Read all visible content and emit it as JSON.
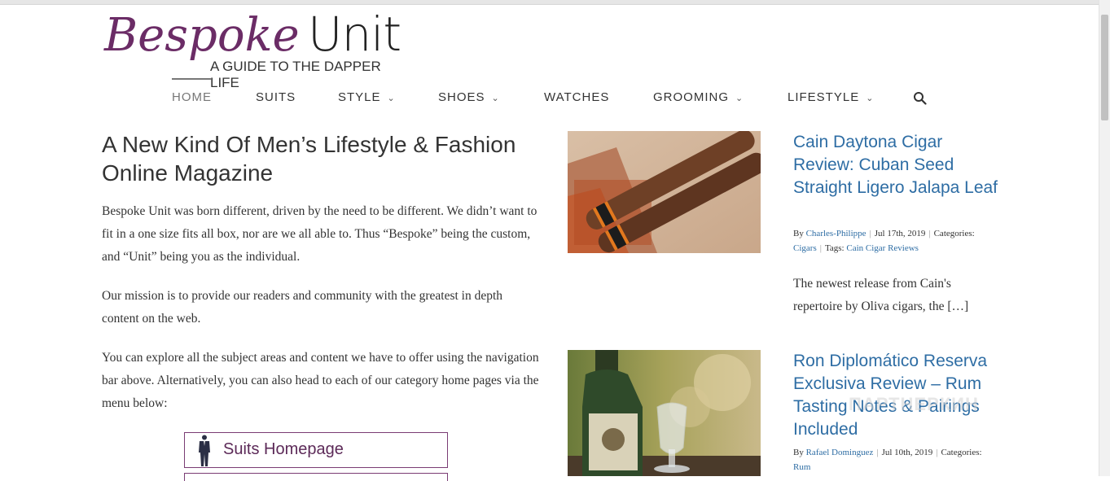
{
  "logo": {
    "script": "Bespoke",
    "unit": "Unit",
    "tagline": "A GUIDE TO THE DAPPER LIFE"
  },
  "nav": {
    "home": "HOME",
    "suits": "SUITS",
    "style": "STYLE",
    "shoes": "SHOES",
    "watches": "WATCHES",
    "grooming": "GROOMING",
    "lifestyle": "LIFESTYLE"
  },
  "intro": {
    "headline": "A New Kind Of Men’s Lifestyle & Fashion Online Magazine",
    "p1": "Bespoke Unit was born different, driven by the need to be different. We didn’t want to fit in a one size fits all box, nor are we all able to. Thus “Bespoke” being the custom, and “Unit” being you as the individual.",
    "p2": "Our mission is to provide our readers and community with the greatest in depth content on the web.",
    "p3": "You can explore all the subject areas and content we have to offer using the navigation bar above. Alternatively, you can also head to each of our category home pages via the menu below:",
    "button1": "Suits Homepage"
  },
  "posts": [
    {
      "title": "Cain Daytona Cigar Review: Cuban Seed Straight Ligero Jalapa Leaf",
      "by": "By",
      "author": "Charles-Philippe",
      "date": "Jul 17th, 2019",
      "categories_label": "Categories:",
      "category": "Cigars",
      "tags_label": "Tags:",
      "tag": "Cain Cigar Reviews",
      "excerpt": "The newest release from Cain's repertoire by Oliva cigars, the […]"
    },
    {
      "title": "Ron Diplomático Reserva Exclusiva Review – Rum Tasting Notes & Pairings Included",
      "by": "By",
      "author": "Rafael Dominguez",
      "date": "Jul 10th, 2019",
      "categories_label": "Categories:",
      "category": "Rum"
    }
  ],
  "watermark": "ПАРТНЕРКИН",
  "colors": {
    "brand": "#6b2c66",
    "link": "#2e6da4",
    "button_border": "#7a3c74"
  }
}
